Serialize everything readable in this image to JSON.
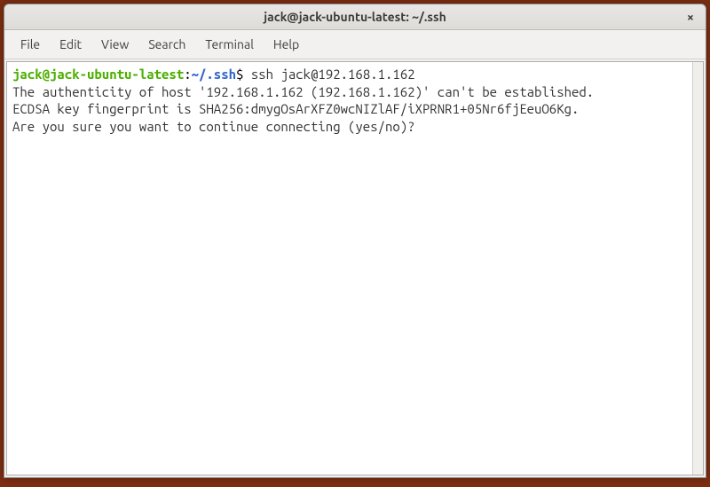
{
  "titlebar": {
    "title": "jack@jack-ubuntu-latest: ~/.ssh",
    "close": "×"
  },
  "menubar": {
    "items": [
      {
        "label": "File"
      },
      {
        "label": "Edit"
      },
      {
        "label": "View"
      },
      {
        "label": "Search"
      },
      {
        "label": "Terminal"
      },
      {
        "label": "Help"
      }
    ]
  },
  "terminal": {
    "prompt_user_host": "jack@jack-ubuntu-latest",
    "prompt_colon": ":",
    "prompt_path": "~/.ssh",
    "prompt_dollar": "$",
    "command": " ssh jack@192.168.1.162",
    "output_line_1": "The authenticity of host '192.168.1.162 (192.168.1.162)' can't be established.",
    "output_line_2": "ECDSA key fingerprint is SHA256:dmygOsArXFZ0wcNIZlAF/iXPRNR1+05Nr6fjEeuO6Kg.",
    "output_line_3": "Are you sure you want to continue connecting (yes/no)? "
  }
}
